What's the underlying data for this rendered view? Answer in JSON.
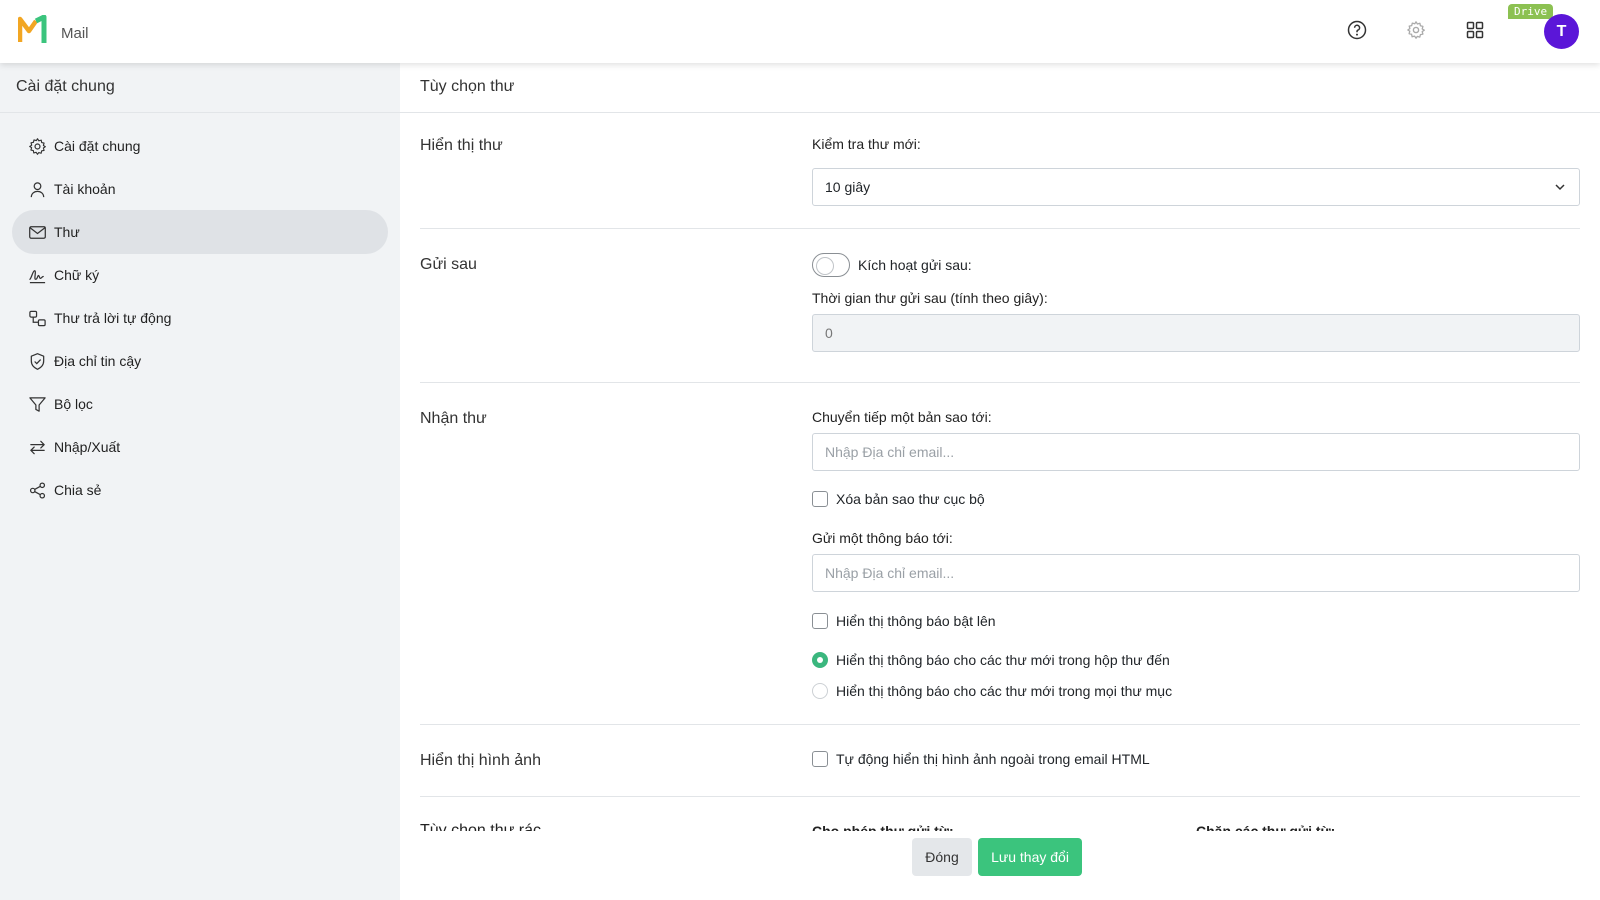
{
  "header": {
    "app_name": "Mail",
    "drive_badge": "Drive",
    "avatar_letter": "T",
    "colors": {
      "logo_orange": "#f2a623",
      "logo_green": "#3bc47d",
      "avatar": "#5b16d8",
      "drive_badge": "#8cc152"
    }
  },
  "sidebar": {
    "title": "Cài đặt chung",
    "items": [
      {
        "label": "Cài đặt chung",
        "icon": "gear-icon"
      },
      {
        "label": "Tài khoản",
        "icon": "user-icon"
      },
      {
        "label": "Thư",
        "icon": "mail-icon",
        "active": true
      },
      {
        "label": "Chữ ký",
        "icon": "signature-icon"
      },
      {
        "label": "Thư trả lời tự động",
        "icon": "auto-reply-icon"
      },
      {
        "label": "Địa chỉ tin cậy",
        "icon": "shield-icon"
      },
      {
        "label": "Bộ lọc",
        "icon": "filter-icon"
      },
      {
        "label": "Nhập/Xuất",
        "icon": "import-export-icon"
      },
      {
        "label": "Chia sẻ",
        "icon": "share-icon"
      }
    ]
  },
  "main": {
    "title": "Tùy chọn thư",
    "display": {
      "label": "Hiển thị thư",
      "check_new_label": "Kiểm tra thư mới:",
      "check_new_value": "10 giây"
    },
    "send_later": {
      "label": "Gửi sau",
      "toggle_label": "Kích hoạt gửi sau:",
      "toggle_on": false,
      "delay_label": "Thời gian thư gửi sau (tính theo giây):",
      "delay_value": "0"
    },
    "receive": {
      "label": "Nhận thư",
      "forward_label": "Chuyển tiếp một bản sao tới:",
      "forward_placeholder": "Nhập Địa chỉ email...",
      "delete_local_label": "Xóa bản sao thư cục bộ",
      "notify_label": "Gửi một thông báo tới:",
      "notify_placeholder": "Nhập Địa chỉ email...",
      "popup_label": "Hiển thị thông báo bật lên",
      "radio_inbox_label": "Hiển thị thông báo cho các thư mới trong hộp thư đến",
      "radio_all_label": "Hiển thị thông báo cho các thư mới trong mọi thư mục",
      "radio_selected": "inbox"
    },
    "images": {
      "label": "Hiển thị hình ảnh",
      "auto_show_label": "Tự động hiển thị hình ảnh ngoài trong email HTML"
    },
    "spam": {
      "label": "Tùy chọn thư rác",
      "allow_label": "Cho phép thư gửi từ:",
      "block_label": "Chặn các thư gửi từ:"
    },
    "buttons": {
      "close": "Đóng",
      "save": "Lưu thay đổi"
    }
  }
}
